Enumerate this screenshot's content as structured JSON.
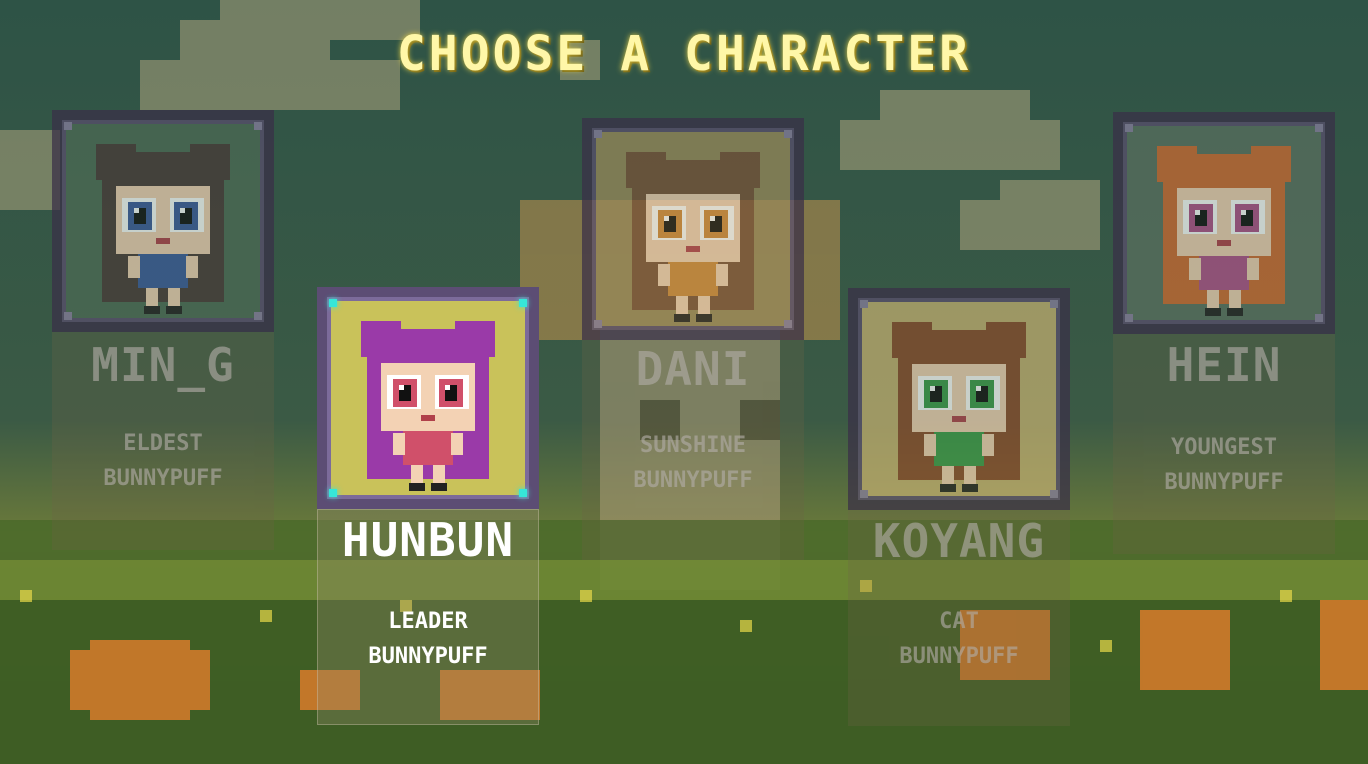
{
  "title": "CHOOSE A CHARACTER",
  "selected": "HUNBUN",
  "colors": {
    "title": "#fff7a8",
    "selected_accent": "#36e6d8",
    "frame": "#3a2f48",
    "dim_text": "#a9a39a"
  },
  "characters": [
    {
      "name": "MIN_G",
      "role_line1": "ELDEST",
      "role_line2": "BUNNYPUFF",
      "eye": "#3b5a9c",
      "hair": "#4a3a38",
      "bg": "#4d6b55",
      "icon": "girl-portrait-icon"
    },
    {
      "name": "HUNBUN",
      "role_line1": "LEADER",
      "role_line2": "BUNNYPUFF",
      "eye": "#d0506a",
      "hair": "#9a3aa8",
      "bg": "#c9c25a",
      "icon": "girl-portrait-icon"
    },
    {
      "name": "DANI",
      "role_line1": "SUNSHINE",
      "role_line2": "BUNNYPUFF",
      "eye": "#d08a3a",
      "hair": "#7a5238",
      "bg": "#9a8a5a",
      "icon": "girl-portrait-icon"
    },
    {
      "name": "KOYANG",
      "role_line1": "CAT",
      "role_line2": "BUNNYPUFF",
      "eye": "#3a9a48",
      "hair": "#8a4a2a",
      "bg": "#c4b070",
      "icon": "girl-portrait-icon"
    },
    {
      "name": "HEIN",
      "role_line1": "YOUNGEST",
      "role_line2": "BUNNYPUFF",
      "eye": "#b0508a",
      "hair": "#d06a30",
      "bg": "#5a7060",
      "icon": "girl-portrait-icon"
    }
  ]
}
